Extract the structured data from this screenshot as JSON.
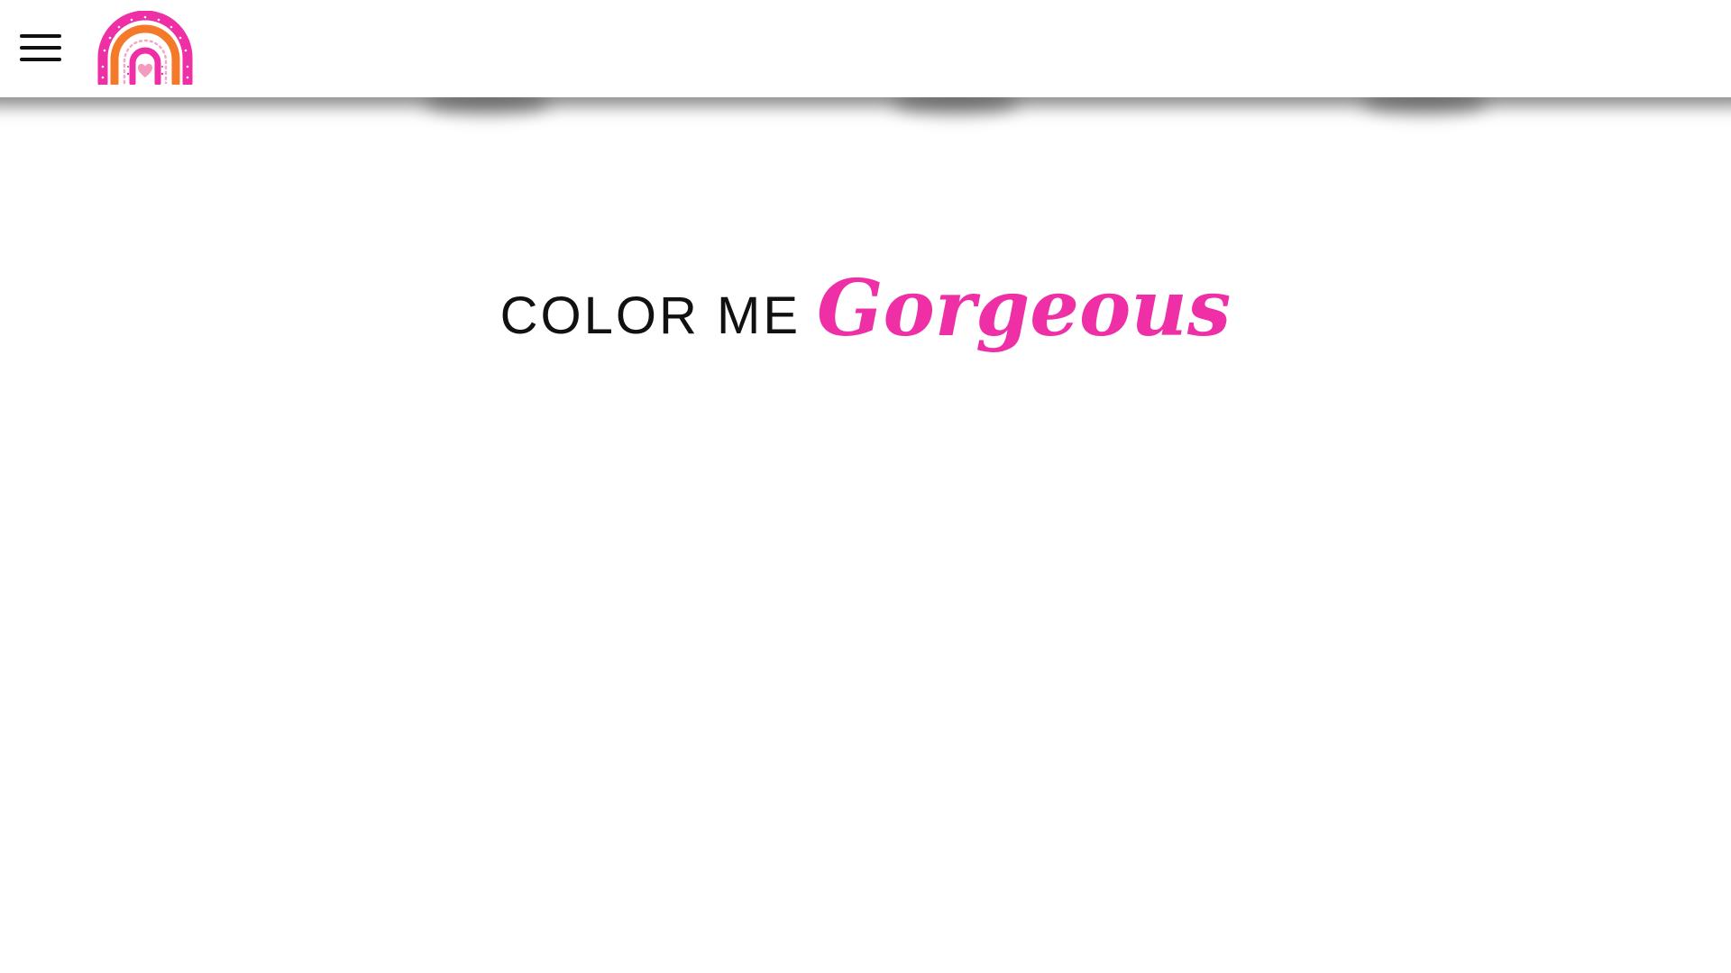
{
  "header": {
    "menu_icon": "hamburger-menu-icon",
    "logo_icon": "rainbow-heart-logo",
    "colors": {
      "pink": "#ee2fa6",
      "orange": "#f47a2a",
      "light_pink": "#f6a8c8"
    }
  },
  "hero": {
    "title_plain": "COLOR ME",
    "title_script": "Gorgeous",
    "script_color": "#ee2fa6"
  }
}
